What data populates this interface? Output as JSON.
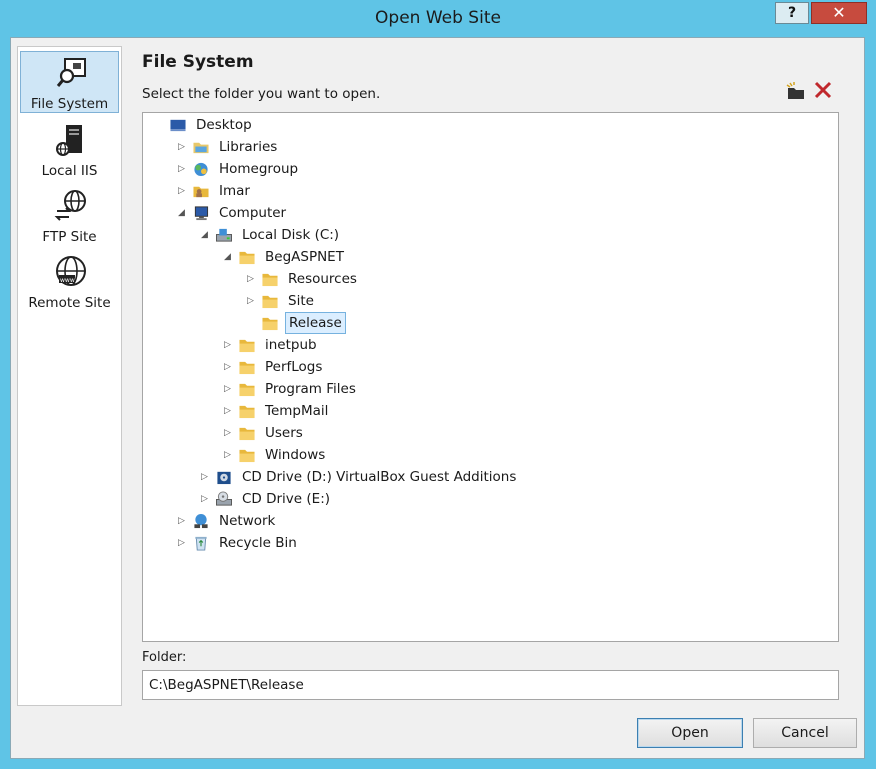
{
  "window": {
    "title": "Open Web Site",
    "help": "?",
    "close": "✕"
  },
  "sidebar": {
    "items": [
      {
        "label": "File System",
        "icon": "file-system-icon",
        "selected": true
      },
      {
        "label": "Local IIS",
        "icon": "server-icon"
      },
      {
        "label": "FTP Site",
        "icon": "globe-transfer-icon"
      },
      {
        "label": "Remote Site",
        "icon": "globe-www-icon"
      }
    ]
  },
  "main": {
    "heading": "File System",
    "instruction": "Select the folder you want to open.",
    "tree": {
      "nodes": [
        {
          "label": "Desktop",
          "icon": "desktop-icon",
          "level": 0,
          "expander": "none"
        },
        {
          "label": "Libraries",
          "icon": "libraries-icon",
          "level": 1,
          "expander": "collapsed"
        },
        {
          "label": "Homegroup",
          "icon": "homegroup-icon",
          "level": 1,
          "expander": "collapsed"
        },
        {
          "label": "Imar",
          "icon": "user-folder-icon",
          "level": 1,
          "expander": "collapsed"
        },
        {
          "label": "Computer",
          "icon": "computer-icon",
          "level": 1,
          "expander": "expanded"
        },
        {
          "label": "Local Disk (C:)",
          "icon": "disk-icon",
          "level": 2,
          "expander": "expanded"
        },
        {
          "label": "BegASPNET",
          "icon": "folder-icon",
          "level": 3,
          "expander": "expanded"
        },
        {
          "label": "Resources",
          "icon": "folder-icon",
          "level": 4,
          "expander": "collapsed"
        },
        {
          "label": "Site",
          "icon": "folder-icon",
          "level": 4,
          "expander": "collapsed"
        },
        {
          "label": "Release",
          "icon": "folder-icon",
          "level": 4,
          "expander": "none",
          "selected": true
        },
        {
          "label": "inetpub",
          "icon": "folder-icon",
          "level": 3,
          "expander": "collapsed"
        },
        {
          "label": "PerfLogs",
          "icon": "folder-icon",
          "level": 3,
          "expander": "collapsed"
        },
        {
          "label": "Program Files",
          "icon": "folder-icon",
          "level": 3,
          "expander": "collapsed"
        },
        {
          "label": "TempMail",
          "icon": "folder-icon",
          "level": 3,
          "expander": "collapsed"
        },
        {
          "label": "Users",
          "icon": "folder-icon",
          "level": 3,
          "expander": "collapsed"
        },
        {
          "label": "Windows",
          "icon": "folder-icon",
          "level": 3,
          "expander": "collapsed"
        },
        {
          "label": "CD Drive (D:) VirtualBox Guest Additions",
          "icon": "cd-box-icon",
          "level": 2,
          "expander": "collapsed"
        },
        {
          "label": "CD Drive (E:)",
          "icon": "cd-drive-icon",
          "level": 2,
          "expander": "collapsed"
        },
        {
          "label": "Network",
          "icon": "network-icon",
          "level": 1,
          "expander": "collapsed"
        },
        {
          "label": "Recycle Bin",
          "icon": "recycle-bin-icon",
          "level": 1,
          "expander": "collapsed"
        }
      ]
    },
    "folder_label": "Folder:",
    "folder_value": "C:\\BegASPNET\\Release"
  },
  "buttons": {
    "open": "Open",
    "cancel": "Cancel"
  },
  "colors": {
    "titlebar": "#5fc4e6",
    "close_button": "#c74b3e",
    "selection": "#dbeeff",
    "folder": "#e8b83c"
  }
}
